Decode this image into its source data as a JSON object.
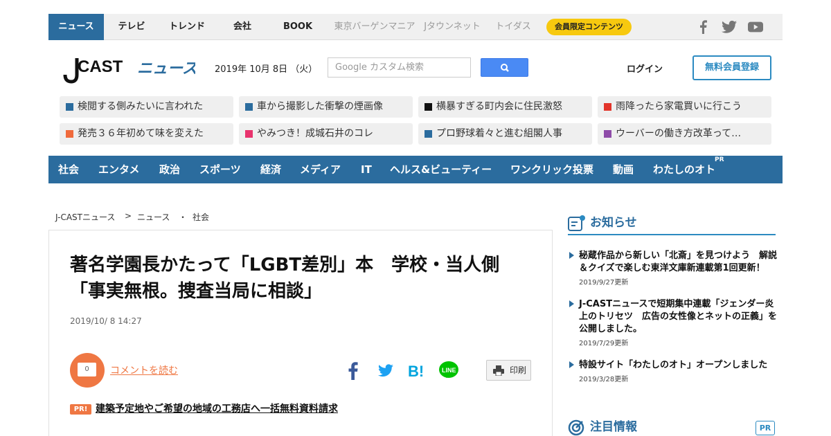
{
  "top_nav": {
    "items": [
      "ニュース",
      "テレビ",
      "トレンド",
      "会社",
      "BOOK",
      "東京バーゲンマニア",
      "Jタウンネット",
      "トイダス"
    ],
    "member_button": "会員限定コンテンツ",
    "social": [
      "facebook-icon",
      "twitter-icon",
      "youtube-icon"
    ]
  },
  "header": {
    "logo_text": "J-CAST ニュース",
    "date": "2019年 10月 8日 （火）",
    "search_placeholder": "Google カスタム検索",
    "login": "ログイン",
    "register": "無料会員登録"
  },
  "headlines": [
    {
      "text": "検閲する側みたいに言われた",
      "color": "#2b6c9e"
    },
    {
      "text": "車から撮影した衝撃の煙画像",
      "color": "#2b6c9e"
    },
    {
      "text": "横暴すぎる町内会に住民激怒",
      "color": "#111111"
    },
    {
      "text": "雨降ったら家電買いに行こう",
      "color": "#e2342a"
    },
    {
      "text": "発売３６年初めて味を変えた",
      "color": "#f06a3c"
    },
    {
      "text": "やみつき！成城石井のコレ",
      "color": "#e8336d"
    },
    {
      "text": "プロ野球着々と進む組閣人事",
      "color": "#2b6c9e"
    },
    {
      "text": "ウーバーの働き方改革って…",
      "color": "#8e4ba8"
    }
  ],
  "categories": [
    "社会",
    "エンタメ",
    "政治",
    "スポーツ",
    "経済",
    "メディア",
    "IT",
    "ヘルス&ビューティー",
    "ワンクリック投票",
    "動画",
    "わたしのオト"
  ],
  "categories_pr": "PR",
  "breadcrumb": {
    "home": "J-CASTニュース",
    "sep1": ">",
    "section": "ニュース",
    "sep2": "・",
    "category": "社会"
  },
  "article": {
    "title": "著名学園長かたって「LGBT差別」本　学校・当人側「事実無根。捜査当局に相談」",
    "date": "2019/10/ 8 14:27",
    "comment_count": "0",
    "comment_link": "コメントを読む",
    "print": "印刷",
    "pr_badge": "PR!",
    "pr_link": "建築予定地やご希望の地域の工務店へ一括無料資料請求"
  },
  "sidebar": {
    "news_title": "お知らせ",
    "news": [
      {
        "text": "秘蔵作品から新しい「北斎」を見つけよう　解説＆クイズで楽しむ東洋文庫新連載第1回更新！",
        "updated": "2019/9/27更新"
      },
      {
        "text": "J-CASTニュースで短期集中連載「ジェンダー炎上のトリセツ　広告の女性像とネットの正義」を公開しました。",
        "updated": "2019/7/29更新"
      },
      {
        "text": "特設サイト「わたしのオト」オープンしました",
        "updated": "2019/3/28更新"
      }
    ],
    "featured_title": "注目情報",
    "featured_pr": "PR"
  },
  "colors": {
    "brand": "#2b6c9e",
    "accent": "#ef7743",
    "member": "#f7c90f",
    "link_blue": "#2b8ac1"
  }
}
